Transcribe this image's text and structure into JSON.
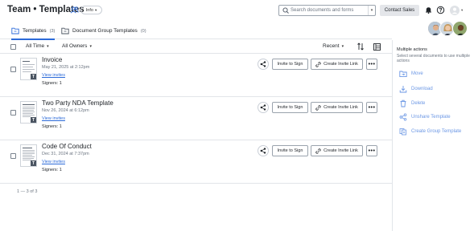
{
  "header": {
    "title": "Team • Templates",
    "info_label": "Info",
    "search_placeholder": "Search documents and forms",
    "contact_label": "Contact Sales"
  },
  "tabs": [
    {
      "label": "Templates",
      "count": "(3)"
    },
    {
      "label": "Document Group Templates",
      "count": "(0)"
    }
  ],
  "toolbar": {
    "time_filter": "All Time",
    "owner_filter": "All Owners",
    "sort_label": "Recent"
  },
  "documents": [
    {
      "name": "Invoice",
      "date": "May 21, 2025 at 2:12pm",
      "link": "View invites",
      "signers": "Signers: 1"
    },
    {
      "name": "Two Party NDA Template",
      "date": "Nov 26, 2024 at 6:12pm",
      "link": "View invites",
      "signers": "Signers: 1"
    },
    {
      "name": "Code Of Conduct",
      "date": "Dec 31, 2024 at 7:37pm",
      "link": "View invites",
      "signers": "Signers: 1"
    }
  ],
  "row_buttons": {
    "invite": "Invite to Sign",
    "create_link": "Create Invite Link",
    "more": "•••"
  },
  "pagination": "1 — 3 of 3",
  "panel": {
    "title": "Multiple actions",
    "description": "Select several documents to use multiple actions",
    "actions": [
      {
        "label": "Move",
        "icon": "folder-move-icon"
      },
      {
        "label": "Download",
        "icon": "download-icon"
      },
      {
        "label": "Delete",
        "icon": "trash-icon"
      },
      {
        "label": "Unshare Template",
        "icon": "unshare-icon"
      },
      {
        "label": "Create Group Template",
        "icon": "group-template-icon"
      }
    ]
  },
  "colors": {
    "accent": "#2b6ad9",
    "text": "#1f2328",
    "muted": "#6b7480",
    "border": "#e2e5e9"
  }
}
